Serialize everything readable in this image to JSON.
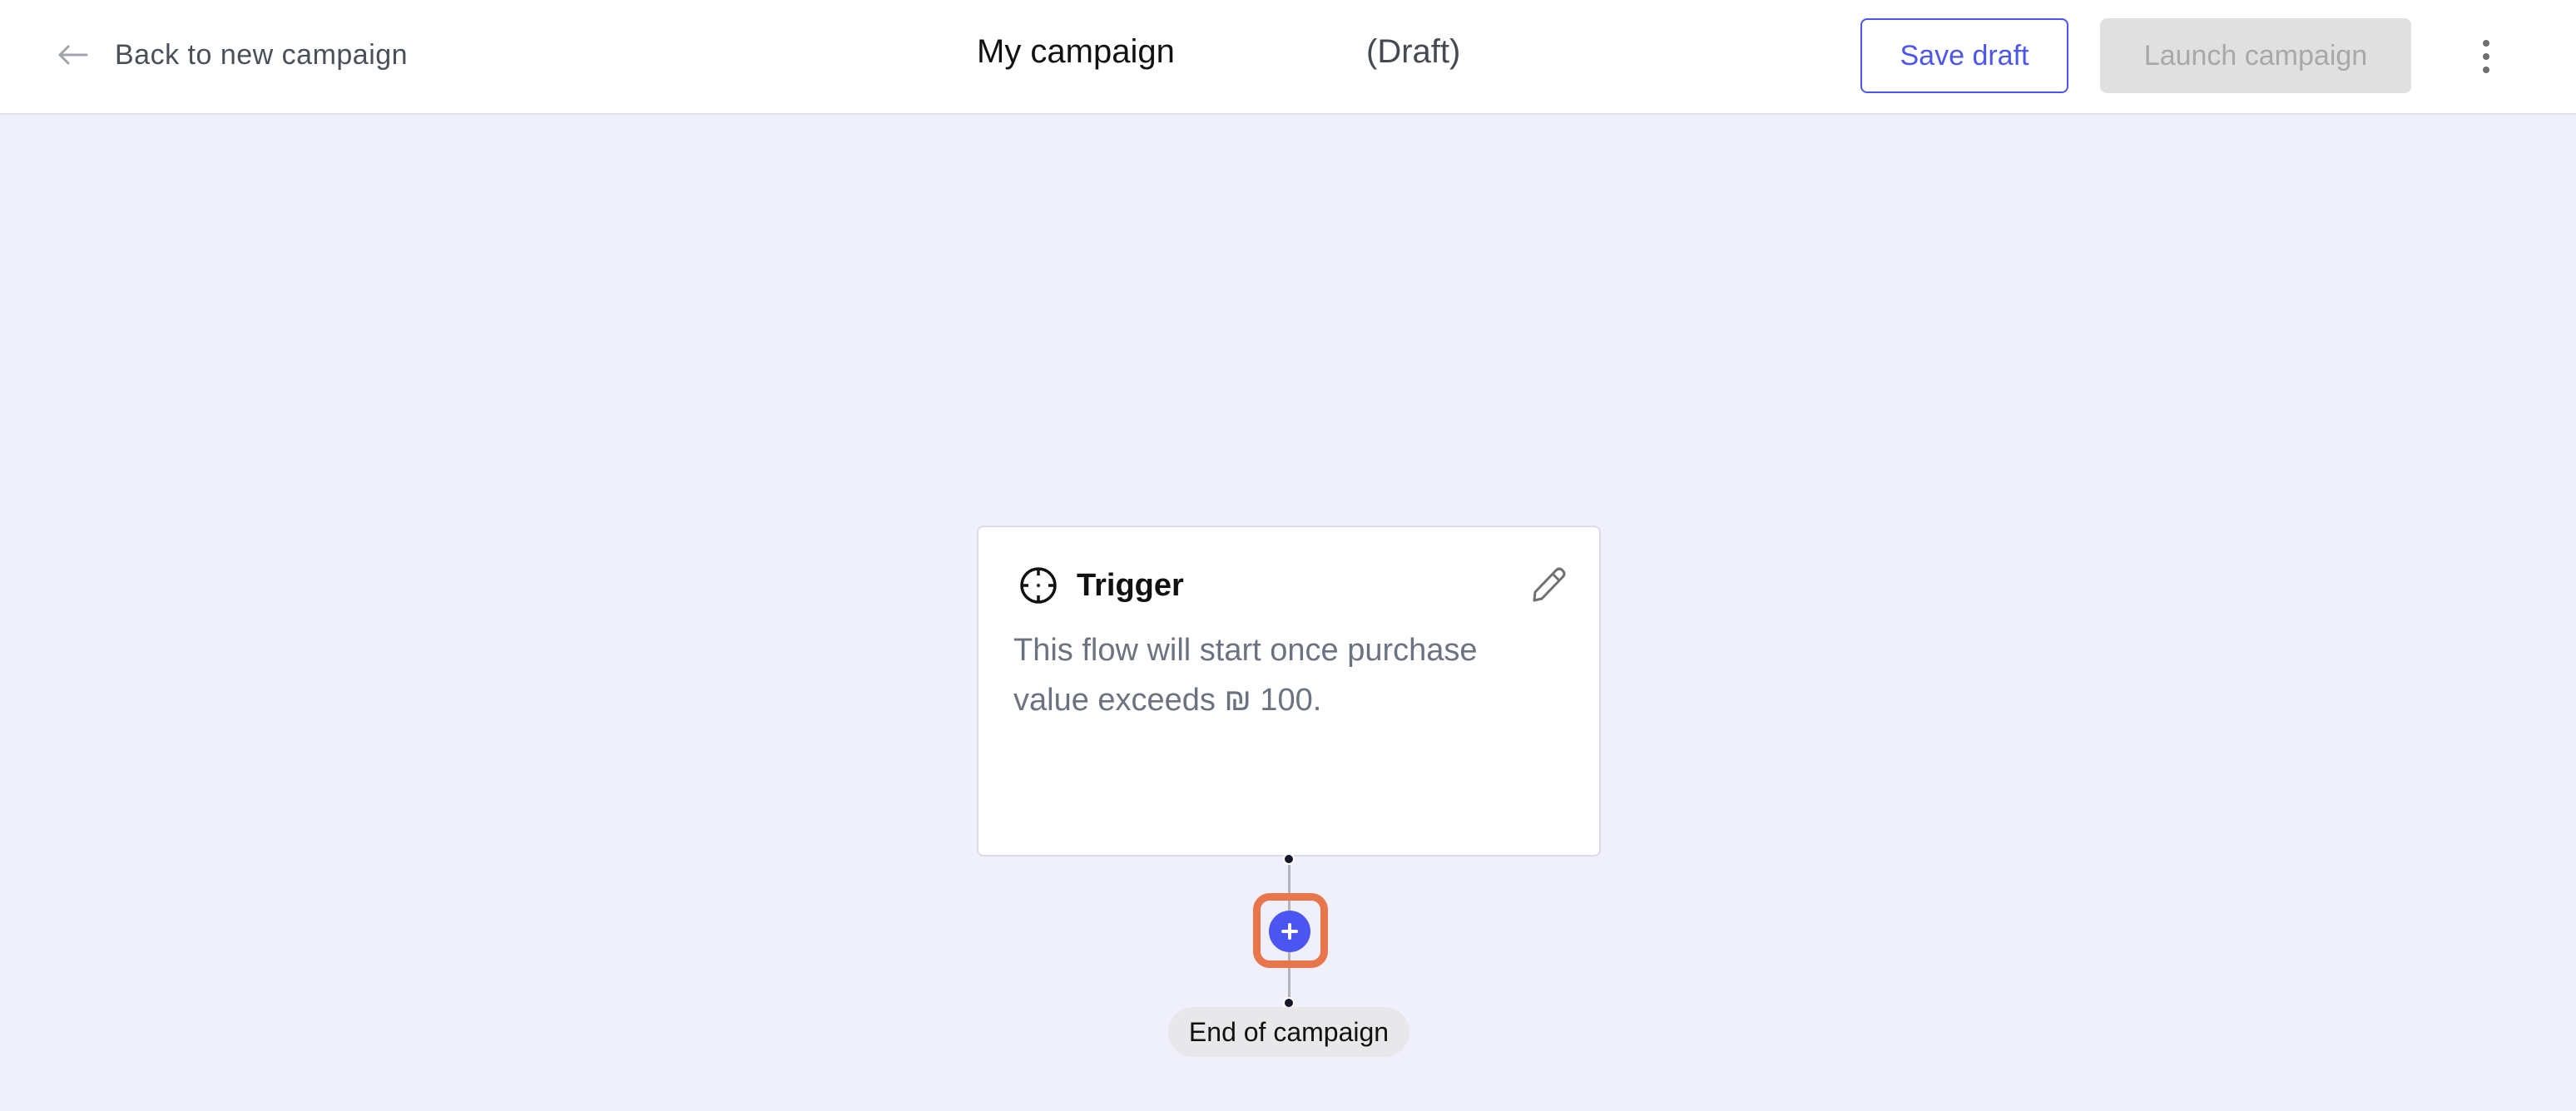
{
  "header": {
    "back_label": "Back to new campaign",
    "title": "My campaign",
    "status": "(Draft)",
    "save_label": "Save draft",
    "launch_label": "Launch campaign",
    "icons": {
      "back": "arrow-left-icon",
      "more": "more-vertical-icon"
    }
  },
  "canvas": {
    "trigger_card": {
      "title": "Trigger",
      "description": "This flow will start once purchase value exceeds ₪ 100.",
      "icons": {
        "type": "crosshair-icon",
        "edit": "pencil-icon"
      }
    },
    "add_step": {
      "icon": "plus-icon",
      "highlight_color": "#e8764a"
    },
    "end_label": "End of campaign"
  },
  "colors": {
    "accent": "#4b55ef",
    "canvas_bg": "#f0f0fc",
    "disabled_bg": "#e0e0e0"
  }
}
